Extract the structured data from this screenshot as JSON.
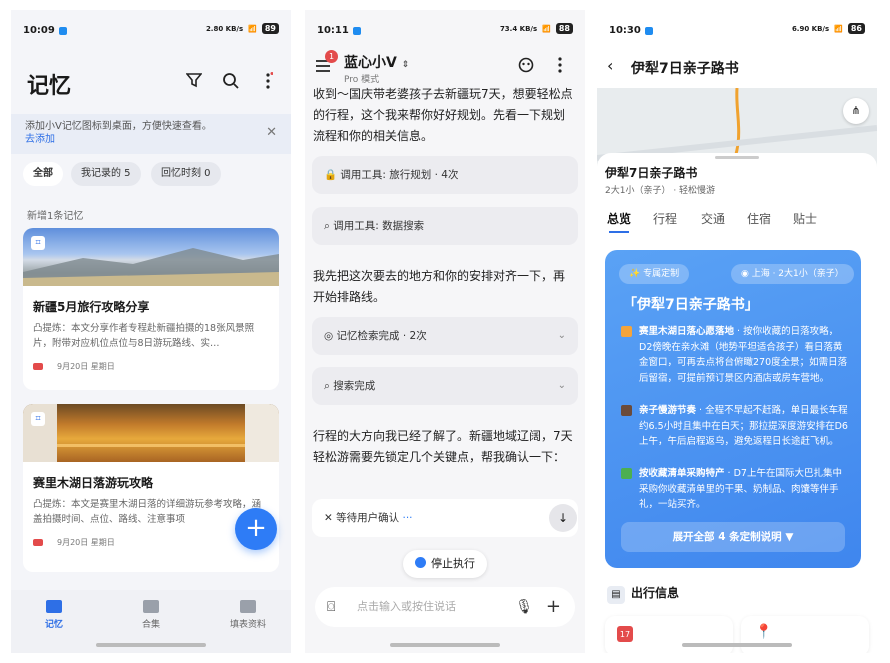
{
  "p1": {
    "time": "10:09",
    "speed": "2.80 KB/s",
    "battery": "89",
    "title": "记忆",
    "tip": {
      "text": "添加小V记忆图标到桌面，方便快速查看。",
      "link": "去添加"
    },
    "chips": [
      "全部",
      "我记录的 5",
      "回忆时刻 0"
    ],
    "section": "新增1条记忆",
    "cards": [
      {
        "title": "新疆5月旅行攻略分享",
        "desc": "凸提炼：本文分享作者专程赴新疆拍摄的18张风景照片，附带对应机位点位与8日游玩路线、实…",
        "date": "9月20日 星期日"
      },
      {
        "title": "赛里木湖日落游玩攻略",
        "desc": "凸提炼：本文是赛里木湖日落的详细游玩参考攻略，涵盖拍摄时间、点位、路线、注意事项",
        "date": "9月20日 星期日"
      }
    ],
    "nav": [
      "记忆",
      "合集",
      "填表资料"
    ]
  },
  "p2": {
    "time": "10:11",
    "speed": "73.4 KB/s",
    "battery": "88",
    "badge": "1",
    "title": "蓝心小V",
    "subtitle": "Pro 模式",
    "intro": "收到～国庆带老婆孩子去新疆玩7天，想要轻松点的行程，这个我来帮你好好规划。先看一下规划流程和你的相关信息。",
    "steps": [
      "调用工具: 旅行规划 · 4次",
      "调用工具: 数据搜索"
    ],
    "mid": "我先把这次要去的地方和你的安排对齐一下，再开始排路线。",
    "steps2": [
      "记忆检索完成 · 2次",
      "搜索完成"
    ],
    "final": "行程的大方向我已经了解了。新疆地域辽阔，7天轻松游需要先锁定几个关键点，帮我确认一下：",
    "waiting": "等待用户确认",
    "stop": "停止执行",
    "input_placeholder": "点击输入或按住说话"
  },
  "p3": {
    "time": "10:30",
    "speed": "6.90 KB/s",
    "battery": "86",
    "title": "伊犁7日亲子路书",
    "sheet_title": "伊犁7日亲子路书",
    "sheet_meta": "2大1小（亲子） · 轻松慢游",
    "tabs": [
      "总览",
      "行程",
      "交通",
      "住宿",
      "贴士"
    ],
    "plan": {
      "tag": "专属定制",
      "loc": "上海 · 2大1小（亲子）",
      "name": "「伊犁7日亲子路书」",
      "items": [
        {
          "title": "赛里木湖日落心愿落地",
          "text": "按你收藏的日落攻略，D2傍晚在亲水滩（地势平坦适合孩子）看日落黄金窗口，可再去点将台俯瞰270度全景；如需日落后留宿，可提前预订景区内酒店或房车营地。",
          "color": "#f5a43a"
        },
        {
          "title": "亲子慢游节奏",
          "text": "全程不早起不赶路，单日最长车程约6.5小时且集中在白天；那拉提深度游安排在D6上午，午后启程返乌，避免返程日长途赶飞机。",
          "color": "#6b4b3a"
        },
        {
          "title": "按收藏清单采购特产",
          "text": "D7上午在国际大巴扎集中采购你收藏清单里的干果、奶制品、肉馕等伴手礼，一站买齐。",
          "color": "#4caf50"
        }
      ],
      "expand": "展开全部 4 条定制说明 ▼"
    },
    "section": "出行信息",
    "date_chip": "17"
  }
}
